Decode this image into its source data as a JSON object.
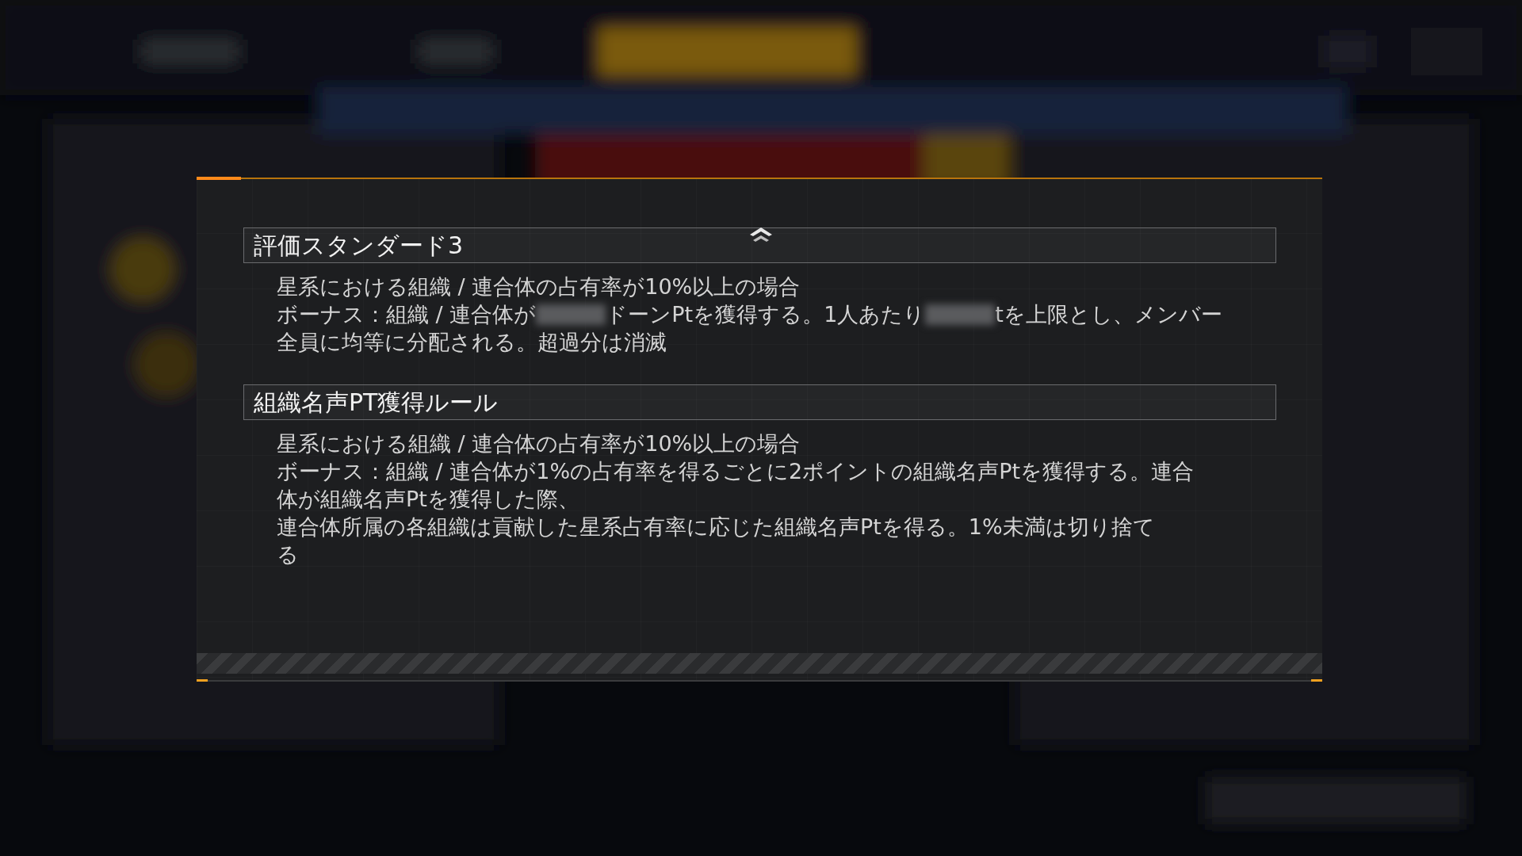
{
  "dialog": {
    "sections": [
      {
        "title": "評価スタンダード3",
        "lines": [
          [
            {
              "text": "星系における組織 / 連合体の占有率が10%以上の場合"
            }
          ],
          [
            {
              "text": "ボーナス：組織 / 連合体が"
            },
            {
              "kind": "redacted"
            },
            {
              "text": "ドーンPtを獲得する。1人あたり"
            },
            {
              "kind": "redacted"
            },
            {
              "text": "tを上限とし、メンバー"
            }
          ],
          [
            {
              "text": "全員に均等に分配される。超過分は消滅"
            }
          ]
        ]
      },
      {
        "title": "組織名声PT獲得ルール",
        "lines": [
          [
            {
              "text": "星系における組織 / 連合体の占有率が10%以上の場合"
            }
          ],
          [
            {
              "text": "ボーナス：組織 / 連合体が1%の占有率を得るごとに2ポイントの組織名声Ptを獲得する。連合"
            }
          ],
          [
            {
              "text": "体が組織名声Ptを獲得した際、"
            }
          ],
          [
            {
              "text": "連合体所属の各組織は貢献した星系占有率に応じた組織名声Ptを得る。1%未満は切り捨て"
            }
          ],
          [
            {
              "text": "る"
            }
          ]
        ]
      }
    ]
  }
}
